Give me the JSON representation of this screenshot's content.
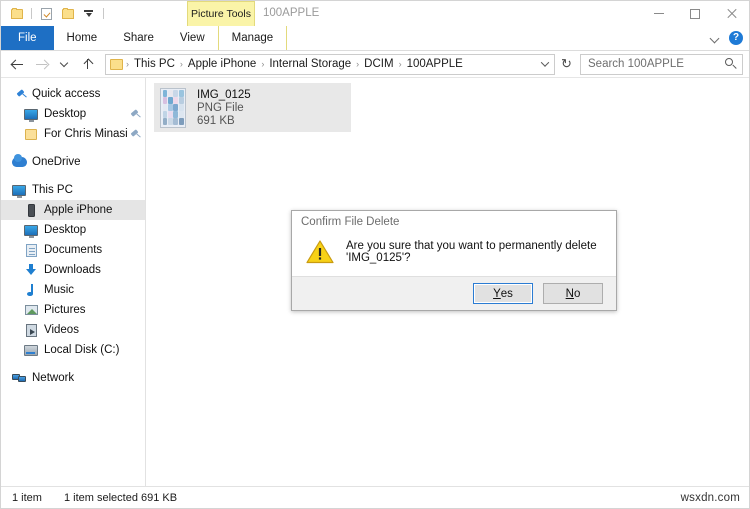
{
  "window": {
    "title": "100APPLE",
    "contextual_tab": "Picture Tools",
    "quick_access": [
      {
        "name": "folder-icon",
        "label": ""
      },
      {
        "name": "properties-icon",
        "label": ""
      },
      {
        "name": "new-folder-icon",
        "label": ""
      },
      {
        "name": "customize-quick-access-icon",
        "label": ""
      }
    ],
    "controls": {
      "minimize": "minimize-icon",
      "maximize": "maximize-icon",
      "close": "close-icon"
    }
  },
  "ribbon": {
    "tabs": [
      {
        "label": "File",
        "selected": true
      },
      {
        "label": "Home",
        "selected": false
      },
      {
        "label": "Share",
        "selected": false
      },
      {
        "label": "View",
        "selected": false
      },
      {
        "label": "Manage",
        "selected": false,
        "contextual": true
      }
    ],
    "collapse_icon": "chevron-down-icon",
    "help_icon": "help-icon",
    "help_glyph": "?"
  },
  "address": {
    "back_icon": "back-arrow-icon",
    "forward_icon": "forward-arrow-icon",
    "recent_icon": "recent-locations-icon",
    "up_icon": "up-arrow-icon",
    "breadcrumbs": [
      "This PC",
      "Apple iPhone",
      "Internal Storage",
      "DCIM",
      "100APPLE"
    ],
    "separator": "›",
    "dropdown_icon": "address-dropdown-icon",
    "refresh_glyph": "↻"
  },
  "search": {
    "placeholder": "Search 100APPLE",
    "icon": "search-icon"
  },
  "sidebar": {
    "items": [
      {
        "label": "Quick access",
        "icon": "pin-icon",
        "level": 0,
        "pinned": false,
        "selected": false
      },
      {
        "label": "Desktop",
        "icon": "monitor-icon",
        "level": 1,
        "pinned": true,
        "selected": false
      },
      {
        "label": "For Chris Minasi",
        "icon": "folder-icon",
        "level": 1,
        "pinned": true,
        "selected": false
      },
      {
        "label": "OneDrive",
        "icon": "cloud-icon",
        "level": 0,
        "pinned": false,
        "selected": false,
        "gap_before": true
      },
      {
        "label": "This PC",
        "icon": "monitor-icon",
        "level": 0,
        "pinned": false,
        "selected": false,
        "gap_before": true
      },
      {
        "label": "Apple iPhone",
        "icon": "phone-icon",
        "level": 1,
        "pinned": false,
        "selected": true
      },
      {
        "label": "Desktop",
        "icon": "monitor-icon",
        "level": 1,
        "pinned": false,
        "selected": false
      },
      {
        "label": "Documents",
        "icon": "documents-icon",
        "level": 1,
        "pinned": false,
        "selected": false
      },
      {
        "label": "Downloads",
        "icon": "downloads-icon",
        "level": 1,
        "pinned": false,
        "selected": false
      },
      {
        "label": "Music",
        "icon": "music-icon",
        "level": 1,
        "pinned": false,
        "selected": false
      },
      {
        "label": "Pictures",
        "icon": "pictures-icon",
        "level": 1,
        "pinned": false,
        "selected": false
      },
      {
        "label": "Videos",
        "icon": "videos-icon",
        "level": 1,
        "pinned": false,
        "selected": false
      },
      {
        "label": "Local Disk (C:)",
        "icon": "disk-icon",
        "level": 1,
        "pinned": false,
        "selected": false
      },
      {
        "label": "Network",
        "icon": "network-icon",
        "level": 0,
        "pinned": false,
        "selected": false,
        "gap_before": true
      }
    ]
  },
  "files": [
    {
      "name": "IMG_0125",
      "type": "PNG File",
      "size": "691 KB",
      "selected": true,
      "thumbnail": "iphone-screenshot-thumbnail"
    }
  ],
  "dialog": {
    "title": "Confirm File Delete",
    "icon": "warning-icon",
    "message": "Are you sure that you want to permanently delete 'IMG_0125'?",
    "buttons": [
      {
        "label": "Yes",
        "mnemonic": "Y",
        "default": true
      },
      {
        "label": "No",
        "mnemonic": "N",
        "default": false
      }
    ]
  },
  "statusbar": {
    "item_count": "1 item",
    "selection": "1 item selected  691 KB"
  },
  "watermark": "wsxdn.com",
  "colors": {
    "accent_blue": "#1e6fc4",
    "contextual_yellow": "#faf4a8",
    "selection_gray": "#e5e5e5",
    "warning_yellow": "#f5c518",
    "focus_blue": "#2b7cd3"
  }
}
